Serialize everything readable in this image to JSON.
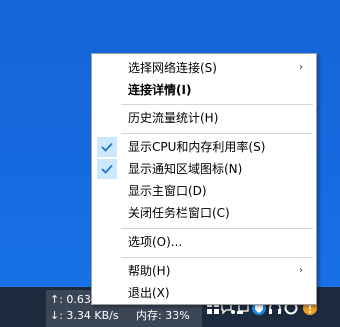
{
  "menu": {
    "items": [
      {
        "label": "选择网络连接(S)",
        "submenu_arrow": "›"
      },
      {
        "label": "连接详情(I)"
      },
      {
        "label": "历史流量统计(H)"
      },
      {
        "label": "显示CPU和内存利用率(S)",
        "checked": true
      },
      {
        "label": "显示通知区域图标(N)",
        "checked": true
      },
      {
        "label": "显示主窗口(D)"
      },
      {
        "label": "关闭任务栏窗口(C)"
      },
      {
        "label": "选项(O)..."
      },
      {
        "label": "帮助(H)",
        "submenu_arrow": "›"
      },
      {
        "label": "退出(X)"
      }
    ]
  },
  "taskbar_widget": {
    "upload": "↑: 0.63",
    "download": "↓: 3.34 KB/s",
    "memory": "内存: 33%"
  },
  "colors": {
    "desktop": "#1669de",
    "taskbar": "#1c2a3d",
    "check_highlight": "#cce8ff",
    "check_mark": "#1e78d2"
  },
  "tray_icons": [
    "grid-icon",
    "chat-icon",
    "network-icon",
    "shield-icon",
    "headset-icon",
    "ring-icon",
    "warning-icon"
  ]
}
